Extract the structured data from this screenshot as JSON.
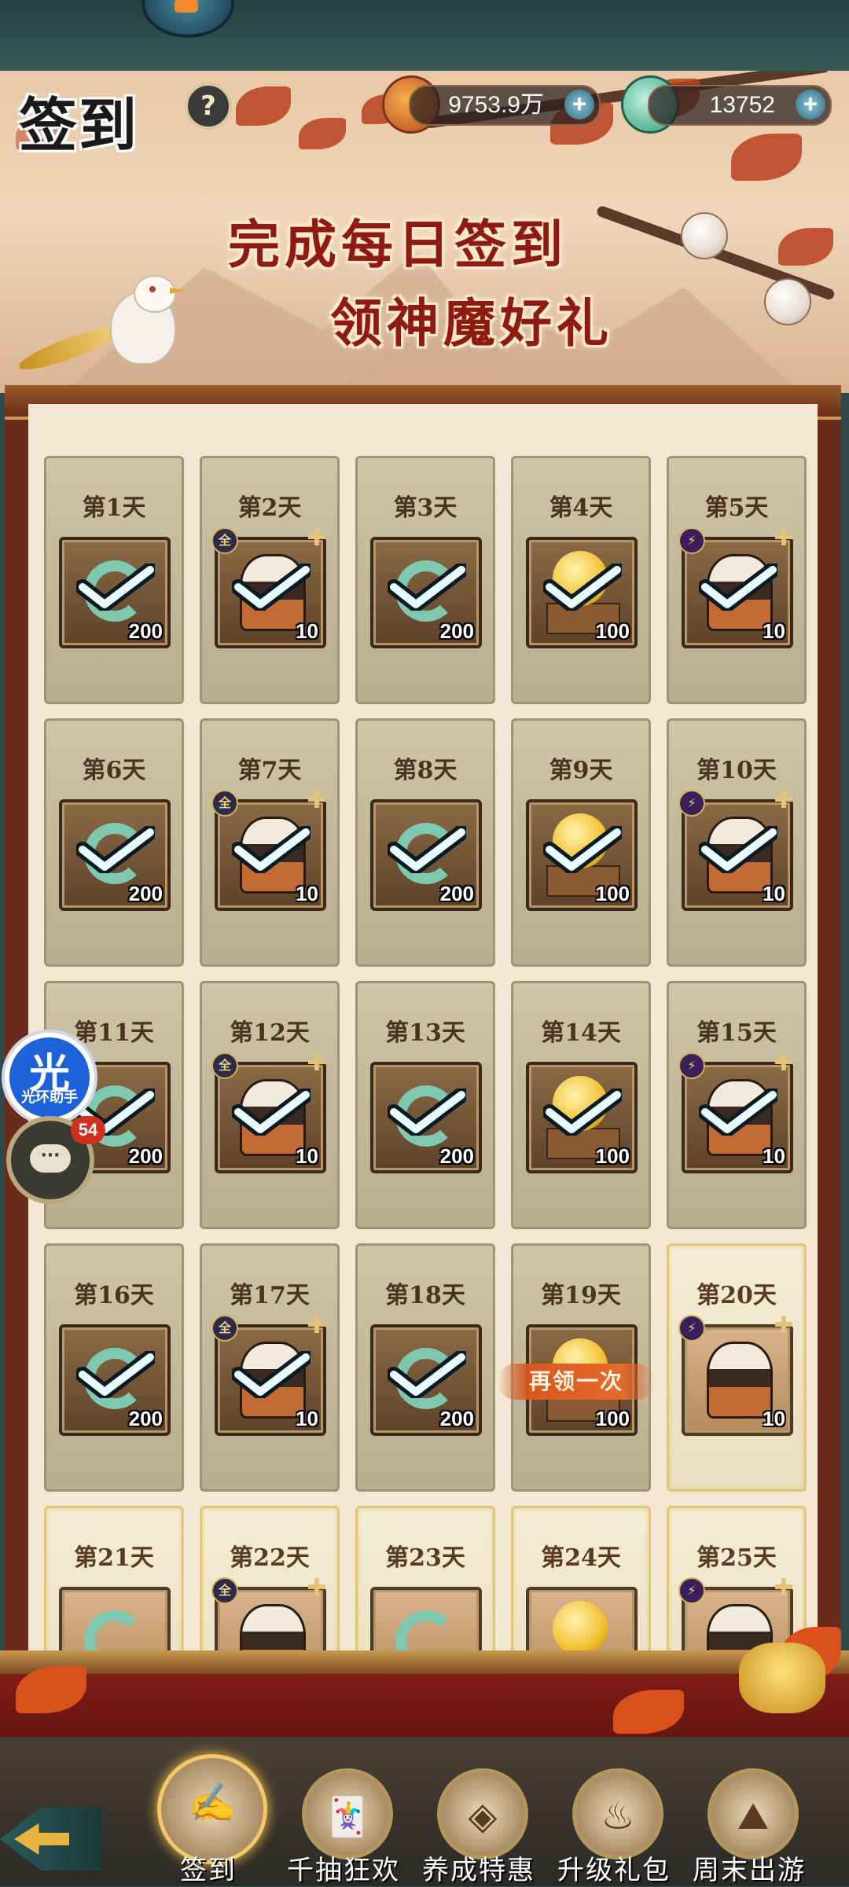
{
  "header": {
    "title": "签到",
    "help": "?",
    "resources": [
      {
        "name": "coins",
        "value": "9753.9万",
        "icon": "coin-string-icon"
      },
      {
        "name": "jade",
        "value": "13752",
        "icon": "jade-dragon-icon"
      }
    ],
    "add_symbol": "+"
  },
  "banner": {
    "line1": "完成每日签到",
    "line2": "领神魔好礼"
  },
  "days": [
    {
      "label": "第1天",
      "item": "jade-dragon",
      "count": "200",
      "claimed": true
    },
    {
      "label": "第2天",
      "item": "hero-figure",
      "count": "10",
      "claimed": true,
      "badge": "全"
    },
    {
      "label": "第3天",
      "item": "jade-dragon",
      "count": "200",
      "claimed": true
    },
    {
      "label": "第4天",
      "item": "gold-pearl",
      "count": "100",
      "claimed": true
    },
    {
      "label": "第5天",
      "item": "hero-figure",
      "count": "10",
      "claimed": true,
      "badge": "⚡"
    },
    {
      "label": "第6天",
      "item": "jade-dragon",
      "count": "200",
      "claimed": true
    },
    {
      "label": "第7天",
      "item": "hero-figure",
      "count": "10",
      "claimed": true,
      "badge": "全"
    },
    {
      "label": "第8天",
      "item": "jade-dragon",
      "count": "200",
      "claimed": true
    },
    {
      "label": "第9天",
      "item": "gold-pearl",
      "count": "100",
      "claimed": true
    },
    {
      "label": "第10天",
      "item": "hero-figure",
      "count": "10",
      "claimed": true,
      "badge": "⚡"
    },
    {
      "label": "第11天",
      "item": "jade-dragon",
      "count": "200",
      "claimed": true
    },
    {
      "label": "第12天",
      "item": "hero-figure",
      "count": "10",
      "claimed": true,
      "badge": "全"
    },
    {
      "label": "第13天",
      "item": "jade-dragon",
      "count": "200",
      "claimed": true
    },
    {
      "label": "第14天",
      "item": "gold-pearl",
      "count": "100",
      "claimed": true
    },
    {
      "label": "第15天",
      "item": "hero-figure",
      "count": "10",
      "claimed": true,
      "badge": "⚡"
    },
    {
      "label": "第16天",
      "item": "jade-dragon",
      "count": "200",
      "claimed": true
    },
    {
      "label": "第17天",
      "item": "hero-figure",
      "count": "10",
      "claimed": true,
      "badge": "全"
    },
    {
      "label": "第18天",
      "item": "jade-dragon",
      "count": "200",
      "claimed": true
    },
    {
      "label": "第19天",
      "item": "gold-pearl",
      "count": "100",
      "claimed": false,
      "again": "再领一次"
    },
    {
      "label": "第20天",
      "item": "hero-figure",
      "count": "10",
      "claimed": false,
      "active": true,
      "badge": "⚡"
    },
    {
      "label": "第21天",
      "item": "jade-dragon",
      "count": "",
      "claimed": false,
      "active": true
    },
    {
      "label": "第22天",
      "item": "hero-figure",
      "count": "",
      "claimed": false,
      "active": true,
      "badge": "全"
    },
    {
      "label": "第23天",
      "item": "jade-dragon",
      "count": "",
      "claimed": false,
      "active": true
    },
    {
      "label": "第24天",
      "item": "gold-pearl",
      "count": "",
      "claimed": false,
      "active": true
    },
    {
      "label": "第25天",
      "item": "hero-figure",
      "count": "",
      "claimed": false,
      "active": true,
      "badge": "⚡"
    }
  ],
  "float": {
    "assistant_char": "光",
    "assistant_label": "光环助手",
    "chat_dots": "···",
    "chat_count": "54"
  },
  "tabs": [
    {
      "label": "签到",
      "icon": "scroll-fan-icon",
      "glyph": "✍",
      "selected": true
    },
    {
      "label": "千抽狂欢",
      "icon": "card-stack-icon",
      "glyph": "🃏",
      "selected": false
    },
    {
      "label": "养成特惠",
      "icon": "treasure-chest-icon",
      "glyph": "◈",
      "selected": false
    },
    {
      "label": "升级礼包",
      "icon": "cauldron-icon",
      "glyph": "♨",
      "selected": false
    },
    {
      "label": "周末出游",
      "icon": "mountain-icon",
      "glyph": "⛰",
      "selected": false
    }
  ],
  "colors": {
    "accent_red": "#8e1a12",
    "gold": "#e1c679",
    "teal": "#2d6b80"
  }
}
